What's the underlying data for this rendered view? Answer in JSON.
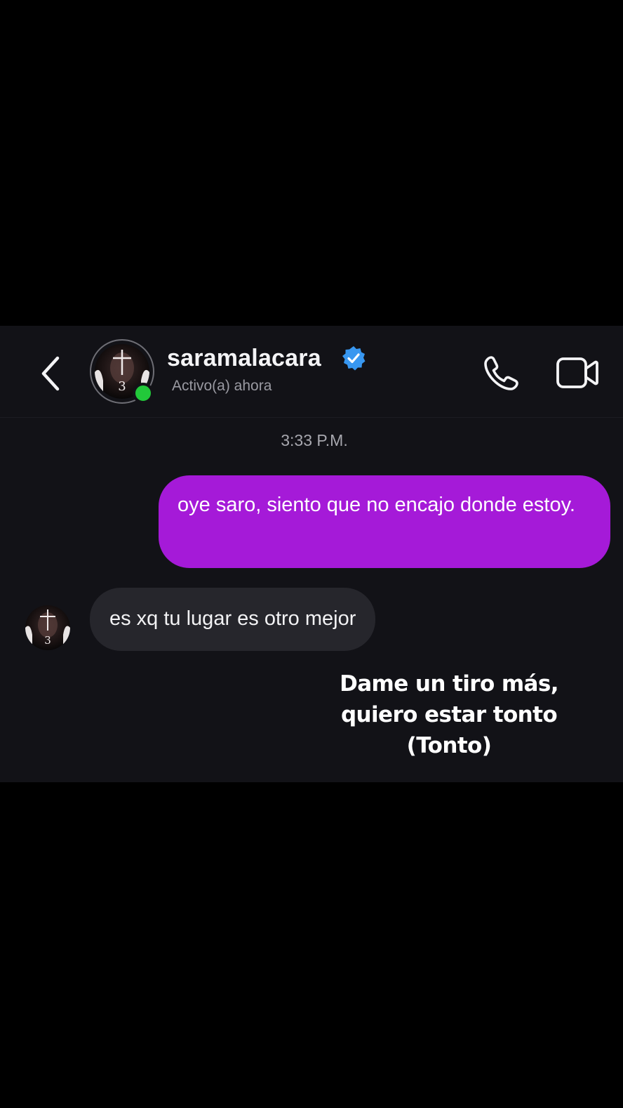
{
  "header": {
    "username": "saramalacara",
    "status": "Activo(a) ahora",
    "avatar_badge": "3",
    "icons": {
      "back": "chevron-left-icon",
      "verified": "verified-badge-icon",
      "call": "phone-icon",
      "video": "video-camera-icon"
    }
  },
  "conversation": {
    "timestamp": "3:33 P.M.",
    "messages": [
      {
        "from": "me",
        "text": "oye saro, siento que no encajo donde estoy."
      },
      {
        "from": "saramalacara",
        "text": "es xq tu lugar es otro mejor"
      }
    ]
  },
  "caption": {
    "lines": [
      "Dame un tiro más,",
      "quiero estar tonto",
      "(Tonto)"
    ]
  },
  "colors": {
    "background": "#000000",
    "chat_background": "#121217",
    "sent_bubble": "#a51ad8",
    "received_bubble": "#26262c",
    "online": "#22c83a",
    "verified": "#3897f0"
  }
}
